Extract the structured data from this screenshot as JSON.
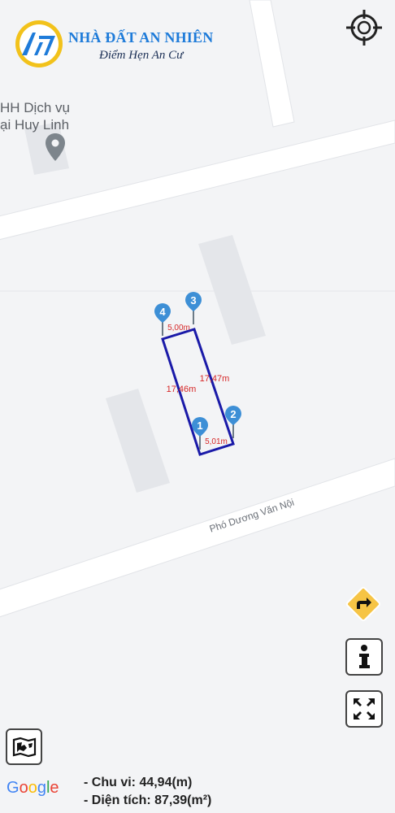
{
  "logo": {
    "title": "NHÀ ĐẤT AN NHIÊN",
    "slogan": "Điểm Hẹn An Cư"
  },
  "poi": {
    "line1": "HH Dịch vụ",
    "line2": "ại Huy Linh"
  },
  "street": {
    "name": "Phó Dương Văn Nội"
  },
  "parcel": {
    "markers": [
      "1",
      "2",
      "3",
      "4"
    ],
    "edges": {
      "top": "5,00m",
      "bottom": "5,01m",
      "right": "17,47m",
      "left": "17,46m"
    }
  },
  "summary": {
    "perimeter": "- Chu vi: 44,94(m)",
    "area": "- Diện tích: 87,39(m²)"
  },
  "google": {
    "letters": [
      "G",
      "o",
      "o",
      "g",
      "l",
      "e"
    ],
    "colors": [
      "#4285F4",
      "#EA4335",
      "#FBBC05",
      "#4285F4",
      "#34A853",
      "#EA4335"
    ]
  },
  "colors": {
    "parcel": "#1a1aa8",
    "marker": "#3d8fd6",
    "edge_label": "#d62828",
    "directions": "#f6c445"
  }
}
